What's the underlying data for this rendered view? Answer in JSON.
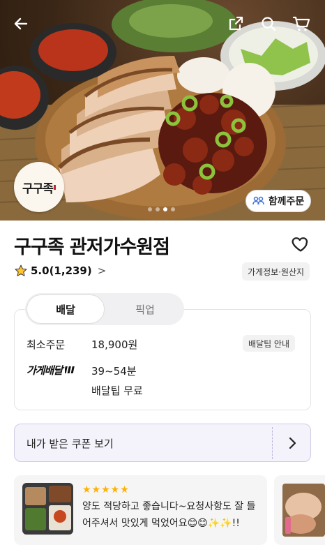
{
  "header": {
    "back_icon": "arrow-left-icon",
    "share_icon": "share-icon",
    "search_icon": "search-icon",
    "cart_icon": "cart-icon"
  },
  "hero": {
    "logo_text": "구구족",
    "carousel": {
      "count": 4,
      "active": 3
    },
    "group_order_label": "함께주문"
  },
  "store": {
    "name": "구구족 관저가수원점",
    "rating": "5.0(1,239)",
    "rating_chevron": ">",
    "info_chip": "가게정보·원산지"
  },
  "delivery": {
    "tabs": [
      {
        "label": "배달",
        "active": true
      },
      {
        "label": "픽업",
        "active": false
      }
    ],
    "min_order_label": "최소주문",
    "min_order_value": "18,900원",
    "tip_guide_label": "배달팁 안내",
    "delivery_brand": "가게배달",
    "delivery_time": "39~54분",
    "delivery_tip": "배달팁 무료"
  },
  "coupon": {
    "label": "내가 받은 쿠폰 보기"
  },
  "review": {
    "stars": "★★★★★",
    "text": "양도 적당하고 좋습니다~요청사항도 잘 들어주셔서 맛있게 먹었어요😊😊✨✨!!"
  },
  "colors": {
    "accent_star": "#ffb100",
    "coupon_bg": "#f4f3fc",
    "group_icon": "#3c6fd8"
  }
}
